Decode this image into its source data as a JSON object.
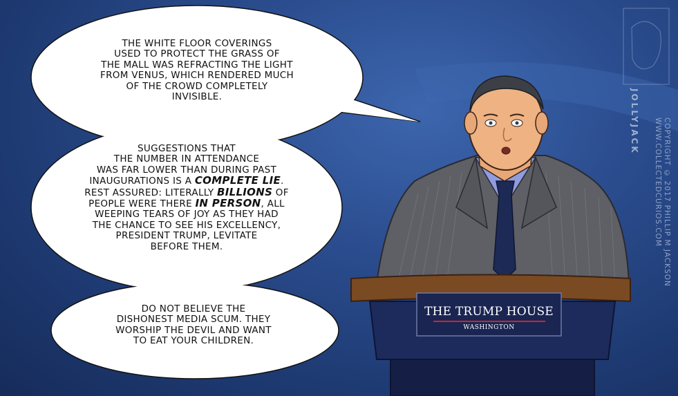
{
  "bubbles": {
    "top": {
      "line1": "The white floor coverings",
      "line2": "used to protect the grass of",
      "line3": "the mall was refracting the light",
      "line4": "from Venus, which rendered much",
      "line5": "of the crowd completely",
      "line6": "invisible."
    },
    "middle": {
      "line1": "Suggestions that",
      "line2": "the number in attendance",
      "line3": "was far lower than during past",
      "line4a": "inaugurations is a ",
      "line4b": "complete lie",
      "line4c": ".",
      "line5a": "Rest assured: literally ",
      "line5b": "billions",
      "line5c": " of",
      "line6a": "people were there ",
      "line6b": "in person",
      "line6c": ", all",
      "line7": "weeping tears of joy as they had",
      "line8": "the chance to see his excellency,",
      "line9": "President Trump, levitate",
      "line10": "before them."
    },
    "bottom": {
      "line1": "Do not believe the",
      "line2": "dishonest media scum. They",
      "line3": "worship the devil and want",
      "line4": "to eat your children."
    }
  },
  "podium": {
    "title": "THE TRUMP HOUSE",
    "subtitle": "WASHINGTON"
  },
  "credits": {
    "signature": "JOLLYJACK",
    "copyright": "COPYRIGHT © 2017 PHILLIP M JACKSON",
    "website": "WWW.COLLECTEDCURIOS.COM"
  },
  "colors": {
    "background": "#2b4d8f",
    "podium_navy": "#1c2a5c",
    "podium_wood": "#7a4a22",
    "suit": "#5f5f66",
    "shirt": "#8f9ce0",
    "tie": "#1d2a55",
    "sign_rule": "#d2232a"
  }
}
